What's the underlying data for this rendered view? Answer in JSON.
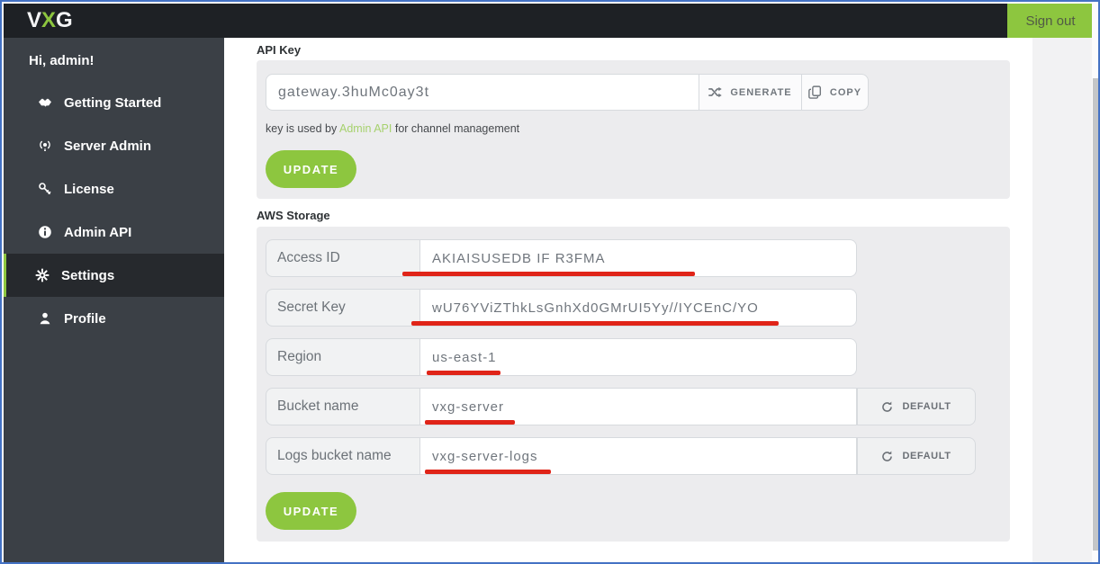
{
  "colors": {
    "accent_green": "#8dc63f",
    "frame_border_blue": "#4472c4",
    "annotation_red": "#e02418",
    "topbar_bg": "#1e2125",
    "sidebar_bg": "#3b4046"
  },
  "topbar": {
    "logo_v": "V",
    "logo_x": "X",
    "logo_g": "G",
    "signout_label": "Sign out"
  },
  "sidebar": {
    "greeting": "Hi, admin!",
    "items": [
      {
        "label": "Getting Started",
        "icon": "handshake-icon",
        "active": false
      },
      {
        "label": "Server Admin",
        "icon": "broadcast-icon",
        "active": false
      },
      {
        "label": "License",
        "icon": "key-icon",
        "active": false
      },
      {
        "label": "Admin API",
        "icon": "info-icon",
        "active": false
      },
      {
        "label": "Settings",
        "icon": "gear-icon",
        "active": true
      },
      {
        "label": "Profile",
        "icon": "person-icon",
        "active": false
      }
    ]
  },
  "api_key_section": {
    "title": "API Key",
    "input_value": "gateway.3huMc0ay3t",
    "generate_label": "GENERATE",
    "copy_label": "COPY",
    "note_prefix": "key is used by ",
    "note_link": "Admin API",
    "note_suffix": " for channel management",
    "update_label": "UPDATE"
  },
  "aws_section": {
    "title": "AWS Storage",
    "rows": [
      {
        "label": "Access ID",
        "value": "AKIAISUSEDB IF R3FMA"
      },
      {
        "label": "Secret Key",
        "value": "wU76YViZThkLsGnhXd0GMrUI5Yy//IYCEnC/YO"
      },
      {
        "label": "Region",
        "value": "us-east-1"
      },
      {
        "label": "Bucket name",
        "value": "vxg-server"
      },
      {
        "label": "Logs bucket name",
        "value": "vxg-server-logs"
      }
    ],
    "default_label": "DEFAULT",
    "update_label": "UPDATE"
  }
}
